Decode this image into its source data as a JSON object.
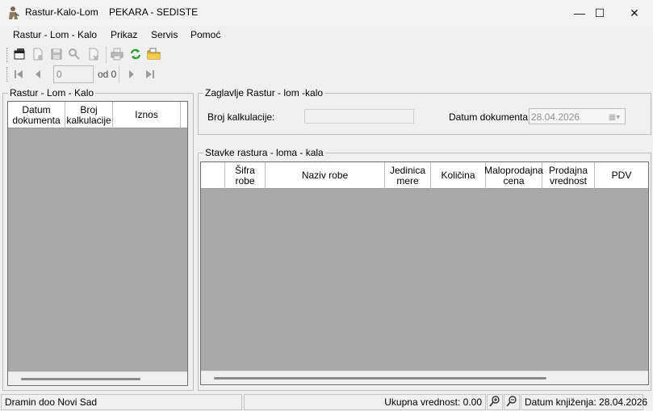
{
  "window": {
    "title": "Rastur-Kalo-Lom    PEKARA - SEDISTE",
    "minimize": "—",
    "maximize": "☐",
    "close": "✕"
  },
  "menu": [
    "Rastur - Lom - Kalo",
    "Prikaz",
    "Servis",
    "Pomoć"
  ],
  "toolbar": {
    "icons": [
      "new-window-icon",
      "new-document-icon",
      "save-icon",
      "search-icon",
      "delete-document-icon",
      "print-icon",
      "refresh-icon",
      "open-folder-icon"
    ]
  },
  "navigator": {
    "position_value": "0",
    "of_label": "od 0"
  },
  "left_panel": {
    "title": "Rastur - Lom - Kalo",
    "columns": [
      "Datum dokumenta",
      "Broj kalkulacije",
      "Iznos"
    ]
  },
  "header_panel": {
    "title": "Zaglavlje Rastur - lom -kalo",
    "broj_label": "Broj kalkulacije:",
    "broj_value": "",
    "datum_label": "Datum dokumenta:",
    "datum_value": "28.04.2026"
  },
  "items_panel": {
    "title": "Stavke rastura - loma - kala",
    "columns": [
      "Šifra robe",
      "Naziv robe",
      "Jedinica mere",
      "Količina",
      "Maloprodajna cena",
      "Prodajna vrednost",
      "PDV"
    ]
  },
  "status": {
    "company": "Dramin doo Novi Sad",
    "total": "Ukupna vrednost: 0.00",
    "posting_date": "Datum knjiženja: 28.04.2026"
  },
  "colors": {
    "grid_background": "#a9a9a9",
    "window_background": "#f0f0f0"
  }
}
